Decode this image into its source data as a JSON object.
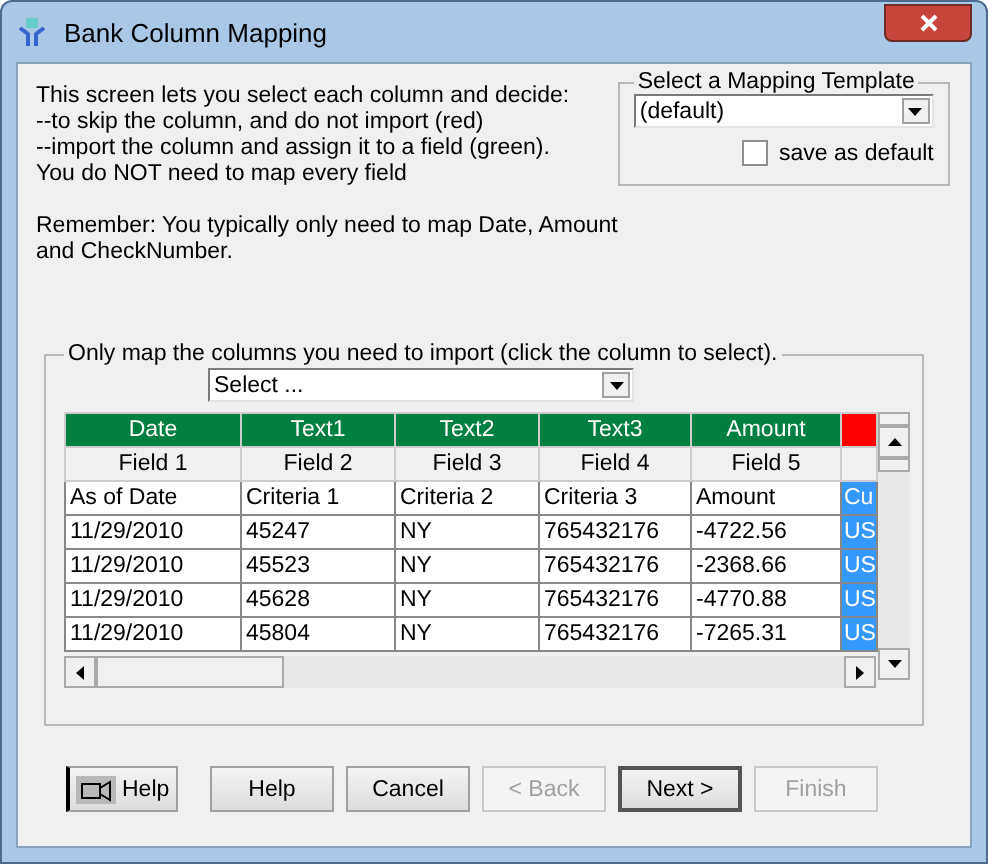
{
  "window": {
    "title": "Bank Column Mapping"
  },
  "instructions": [
    "This screen lets you select each column and decide:",
    "--to skip the column, and do not import (red)",
    "--import the column and assign it to a field (green).",
    "You do NOT need to map every field"
  ],
  "reminder": [
    "Remember:  You typically only need to map Date, Amount",
    "and CheckNumber."
  ],
  "template": {
    "legend": "Select a Mapping Template",
    "value": "(default)",
    "save_default": {
      "label": "save as default",
      "checked": false
    }
  },
  "mapping": {
    "legend": "Only map the columns you need to import (click the column to select).",
    "field_select": {
      "value": "Select ..."
    },
    "columns": [
      {
        "field_name": "Date",
        "position": "Field 1",
        "imported": true,
        "selected": false
      },
      {
        "field_name": "Text1",
        "position": "Field 2",
        "imported": true,
        "selected": false
      },
      {
        "field_name": "Text2",
        "position": "Field 3",
        "imported": true,
        "selected": false
      },
      {
        "field_name": "Text3",
        "position": "Field 4",
        "imported": true,
        "selected": false
      },
      {
        "field_name": "Amount",
        "position": "Field 5",
        "imported": true,
        "selected": false
      },
      {
        "imported": false,
        "selected": true
      }
    ],
    "rows": [
      [
        "As of Date",
        "Criteria 1",
        "Criteria 2",
        "Criteria 3",
        "Amount",
        "Cu"
      ],
      [
        "11/29/2010",
        "45247",
        "NY",
        "765432176",
        "-4722.56",
        "US"
      ],
      [
        "11/29/2010",
        "45523",
        "NY",
        "765432176",
        "-2368.66",
        "US"
      ],
      [
        "11/29/2010",
        "45628",
        "NY",
        "765432176",
        "-4770.88",
        "US"
      ],
      [
        "11/29/2010",
        "45804",
        "NY",
        "765432176",
        "-7265.31",
        "US"
      ]
    ]
  },
  "buttons": [
    {
      "kind": "context-help",
      "label": "Help",
      "disabled": false,
      "default": false
    },
    {
      "kind": "text",
      "label": "Help",
      "disabled": false,
      "default": false
    },
    {
      "kind": "text",
      "label": "Cancel",
      "disabled": false,
      "default": false
    },
    {
      "kind": "text",
      "label": "< Back",
      "disabled": true,
      "default": false
    },
    {
      "kind": "text",
      "label": "Next >",
      "disabled": false,
      "default": true
    },
    {
      "kind": "text",
      "label": "Finish",
      "disabled": true,
      "default": false
    }
  ]
}
